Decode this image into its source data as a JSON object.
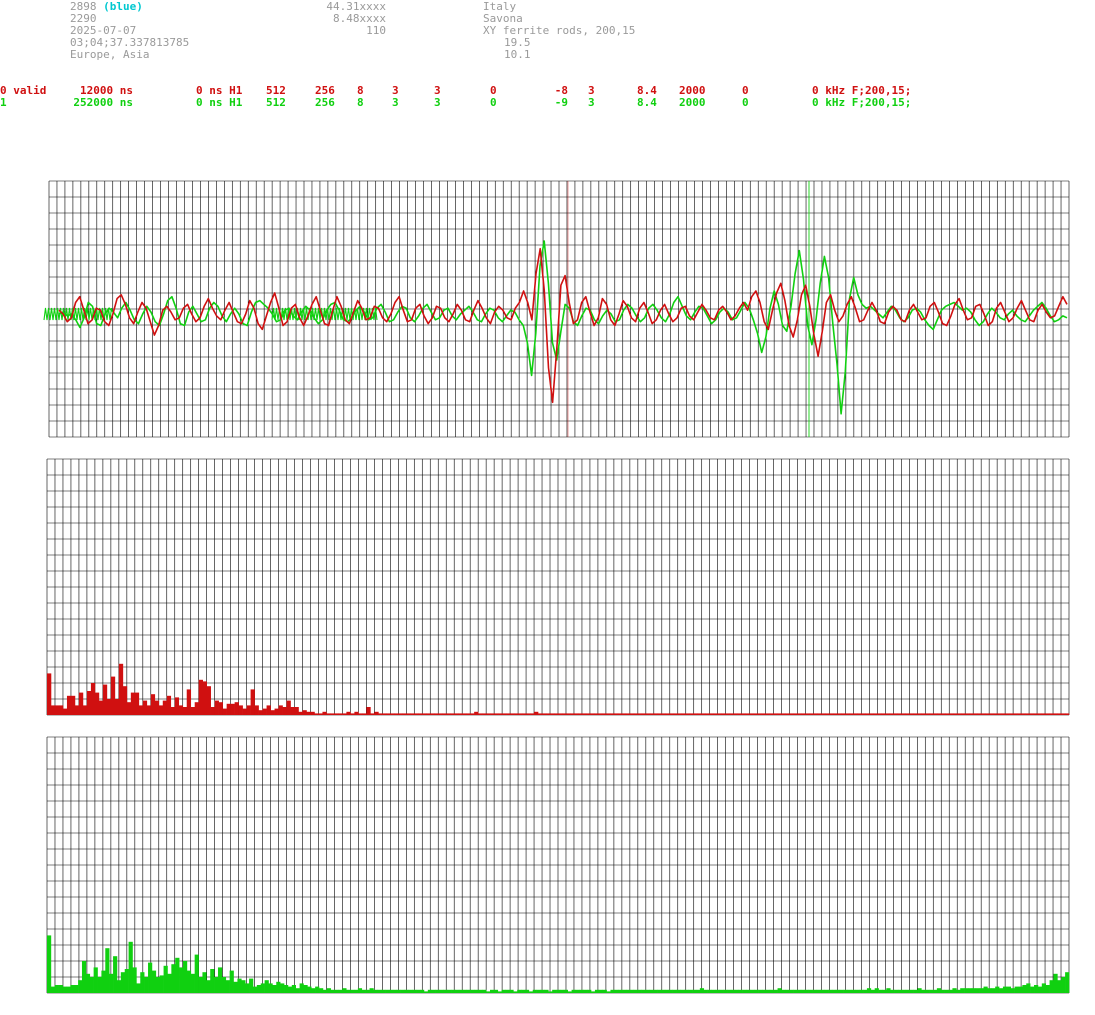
{
  "header": {
    "station_id": "2898",
    "station_tag": "(blue)",
    "station_num2": "2290",
    "date": "2025-07-07",
    "time": "03;04;37.337813785",
    "region": "Europe, Asia",
    "lat": "44.31xxxx",
    "lon": "8.48xxxx",
    "alt": "110",
    "country": "Italy",
    "city": "Savona",
    "antenna": "XY ferrite rods, 200,15",
    "val1": "19.5",
    "val2": "10.1"
  },
  "channels": [
    {
      "c0": "0 valid",
      "c1": "12000 ns",
      "c2": "0 ns H1",
      "c3": "512",
      "c4": "256",
      "c5": "8",
      "c6": "3",
      "c7": "3",
      "c8": "0",
      "c9": "-8",
      "c10": "3",
      "c11": "8.4",
      "c12": "2000",
      "c13": "0",
      "c14": "0 kHz F;200,15;",
      "color": "#d01010"
    },
    {
      "c0": "1",
      "c1": "252000 ns",
      "c2": "0 ns H1",
      "c3": "512",
      "c4": "256",
      "c5": "8",
      "c6": "3",
      "c7": "3",
      "c8": "0",
      "c9": "-9",
      "c10": "3",
      "c11": "8.4",
      "c12": "2000",
      "c13": "0",
      "c14": "0 kHz F;200,15;",
      "color": "#10d010"
    }
  ],
  "chart_data": [
    {
      "type": "line",
      "series": [
        {
          "values": [
            0.2,
            0.0,
            -0.4,
            -0.2,
            0.6,
            0.9,
            0.2,
            -0.5,
            -0.3,
            0.3,
            0.2,
            -0.4,
            -0.6,
            0.0,
            0.8,
            1.0,
            0.5,
            -0.2,
            -0.5,
            0.1,
            0.6,
            0.3,
            -0.4,
            -1.1,
            -0.6,
            0.2,
            0.4,
            0.1,
            -0.3,
            -0.2,
            0.3,
            0.5,
            0.0,
            -0.4,
            -0.2,
            0.4,
            0.8,
            0.3,
            -0.1,
            -0.3,
            0.2,
            0.6,
            0.1,
            -0.4,
            -0.5,
            0.0,
            0.7,
            0.3,
            -0.5,
            -0.8,
            -0.1,
            0.6,
            1.1,
            0.3,
            -0.6,
            -0.4,
            0.3,
            0.5,
            -0.2,
            -0.6,
            -0.1,
            0.5,
            0.9,
            0.2,
            -0.5,
            -0.6,
            0.2,
            0.9,
            0.4,
            -0.3,
            -0.5,
            0.1,
            0.7,
            0.3,
            -0.3,
            -0.2,
            0.4,
            0.3,
            -0.2,
            -0.4,
            0.0,
            0.6,
            0.9,
            0.2,
            -0.4,
            -0.3,
            0.3,
            0.5,
            -0.1,
            -0.5,
            -0.2,
            0.4,
            0.3,
            -0.2,
            -0.4,
            0.0,
            0.5,
            0.2,
            -0.3,
            -0.4,
            0.2,
            0.7,
            0.3,
            -0.2,
            -0.5,
            0.1,
            0.4,
            0.2,
            -0.2,
            -0.3,
            0.3,
            0.6,
            1.2,
            0.6,
            -0.3,
            2.1,
            3.4,
            1.2,
            -2.8,
            -4.6,
            -1.8,
            1.5,
            2.0,
            0.6,
            -0.5,
            -0.3,
            0.6,
            0.9,
            0.1,
            -0.6,
            -0.2,
            0.8,
            0.5,
            -0.3,
            -0.6,
            0.0,
            0.7,
            0.4,
            -0.2,
            -0.4,
            0.3,
            0.6,
            0.1,
            -0.5,
            -0.3,
            0.2,
            0.5,
            0.0,
            -0.4,
            -0.2,
            0.3,
            0.4,
            -0.1,
            -0.3,
            0.1,
            0.5,
            0.2,
            -0.2,
            -0.3,
            0.2,
            0.4,
            0.1,
            -0.3,
            -0.1,
            0.3,
            0.6,
            0.2,
            0.9,
            1.2,
            0.6,
            -0.4,
            -0.8,
            0.2,
            1.1,
            1.6,
            0.7,
            -0.6,
            -1.2,
            -0.3,
            1.0,
            1.5,
            0.4,
            -1.1,
            -2.2,
            -0.9,
            0.6,
            1.0,
            0.2,
            -0.4,
            -0.1,
            0.5,
            0.9,
            0.3,
            -0.4,
            -0.3,
            0.2,
            0.6,
            0.2,
            -0.4,
            -0.5,
            0.1,
            0.4,
            0.2,
            -0.3,
            -0.4,
            0.2,
            0.5,
            0.1,
            -0.3,
            -0.2,
            0.4,
            0.6,
            0.1,
            -0.5,
            -0.6,
            -0.1,
            0.5,
            0.8,
            0.2,
            -0.3,
            -0.2,
            0.4,
            0.5,
            0.0,
            -0.6,
            -0.4,
            0.3,
            0.6,
            0.1,
            -0.4,
            -0.2,
            0.3,
            0.7,
            0.2,
            -0.3,
            -0.4,
            0.2,
            0.5,
            0.1,
            -0.2,
            -0.1,
            0.4,
            0.9,
            0.5
          ]
        },
        {
          "values": [
            0.0,
            0.1,
            -0.1,
            0.0,
            -0.3,
            -0.7,
            -0.2,
            0.6,
            0.4,
            -0.5,
            -0.6,
            0.0,
            0.3,
            0.1,
            -0.2,
            0.3,
            0.6,
            0.2,
            -0.3,
            -0.5,
            0.0,
            0.4,
            0.1,
            -0.4,
            -0.6,
            0.0,
            0.7,
            0.9,
            0.3,
            -0.5,
            -0.6,
            0.1,
            0.4,
            0.0,
            -0.4,
            -0.3,
            0.3,
            0.6,
            0.4,
            -0.1,
            -0.4,
            0.0,
            0.3,
            0.0,
            -0.5,
            -0.6,
            0.1,
            0.6,
            0.7,
            0.5,
            0.3,
            0.0,
            -0.4,
            -0.3,
            0.2,
            0.3,
            -0.1,
            -0.3,
            0.1,
            0.4,
            0.2,
            -0.2,
            -0.5,
            -0.3,
            0.2,
            0.5,
            0.6,
            0.2,
            -0.3,
            -0.4,
            -0.2,
            0.2,
            0.4,
            0.1,
            -0.3,
            -0.2,
            0.3,
            0.5,
            0.1,
            -0.4,
            -0.3,
            0.1,
            0.4,
            0.3,
            -0.2,
            -0.4,
            -0.1,
            0.3,
            0.5,
            0.1,
            -0.3,
            -0.2,
            0.2,
            0.3,
            -0.1,
            -0.3,
            0.0,
            0.2,
            0.4,
            0.1,
            -0.3,
            -0.4,
            0.0,
            0.3,
            0.2,
            -0.2,
            -0.4,
            -0.1,
            0.2,
            0.1,
            -0.3,
            -0.6,
            -1.5,
            -3.2,
            -1.0,
            2.5,
            3.8,
            1.6,
            -1.5,
            -2.4,
            -0.9,
            0.5,
            0.3,
            -0.4,
            -0.6,
            -0.1,
            0.3,
            0.2,
            -0.3,
            -0.5,
            -0.1,
            0.2,
            0.0,
            -0.4,
            -0.3,
            0.2,
            0.5,
            0.3,
            -0.1,
            -0.4,
            -0.2,
            0.3,
            0.5,
            0.2,
            -0.2,
            -0.4,
            0.0,
            0.6,
            0.9,
            0.4,
            -0.1,
            -0.3,
            0.1,
            0.4,
            0.3,
            -0.1,
            -0.5,
            -0.3,
            0.1,
            0.3,
            0.1,
            -0.3,
            -0.2,
            0.2,
            0.6,
            0.3,
            -0.3,
            -1.0,
            -2.0,
            -1.2,
            0.3,
            1.2,
            0.5,
            -0.6,
            -0.9,
            0.4,
            2.1,
            3.3,
            1.8,
            -0.6,
            -1.6,
            -0.3,
            1.6,
            3.0,
            1.9,
            -0.5,
            -2.6,
            -5.2,
            -3.0,
            0.8,
            1.9,
            1.0,
            0.5,
            0.3,
            0.4,
            0.2,
            0.0,
            -0.2,
            0.1,
            0.4,
            0.2,
            -0.2,
            -0.4,
            -0.2,
            0.2,
            0.3,
            0.1,
            -0.3,
            -0.6,
            -0.8,
            -0.3,
            0.2,
            0.4,
            0.5,
            0.6,
            0.4,
            0.2,
            0.3,
            0.1,
            -0.3,
            -0.6,
            -0.4,
            0.0,
            0.3,
            0.1,
            -0.2,
            -0.3,
            0.0,
            0.2,
            -0.1,
            -0.3,
            -0.4,
            -0.1,
            0.2,
            0.4,
            0.6,
            0.3,
            -0.1,
            -0.4,
            -0.3,
            -0.1,
            -0.2
          ]
        }
      ],
      "ylim": [
        -6,
        6
      ],
      "grid": true
    },
    {
      "type": "bar",
      "values": [
        2.6,
        0.6,
        0.6,
        0.6,
        0.4,
        1.2,
        1.2,
        0.6,
        1.4,
        0.6,
        1.5,
        2.0,
        1.4,
        0.9,
        1.9,
        1.0,
        2.4,
        1.0,
        3.2,
        1.8,
        0.8,
        1.4,
        1.4,
        0.6,
        0.9,
        0.6,
        1.3,
        0.9,
        0.6,
        0.9,
        1.2,
        0.5,
        1.1,
        0.6,
        0.5,
        1.6,
        0.5,
        0.8,
        2.2,
        2.1,
        1.8,
        0.5,
        0.9,
        0.8,
        0.4,
        0.7,
        0.7,
        0.8,
        0.6,
        0.4,
        0.6,
        1.6,
        0.6,
        0.3,
        0.4,
        0.6,
        0.3,
        0.4,
        0.6,
        0.5,
        0.9,
        0.5,
        0.5,
        0.2,
        0.3,
        0.2,
        0.2,
        0.1,
        0.1,
        0.2,
        0.1,
        0.1,
        0.1,
        0.1,
        0.1,
        0.2,
        0.1,
        0.2,
        0.1,
        0.1,
        0.5,
        0.1,
        0.2,
        0.1,
        0.1,
        0.1,
        0.1,
        0.1,
        0.1,
        0.1,
        0.1,
        0.1,
        0.1,
        0.1,
        0.1,
        0.1,
        0.1,
        0.1,
        0.1,
        0.1,
        0.1,
        0.1,
        0.1,
        0.1,
        0.1,
        0.1,
        0.1,
        0.2,
        0.1,
        0.1,
        0.1,
        0.1,
        0.1,
        0.1,
        0.1,
        0.1,
        0.1,
        0.1,
        0.1,
        0.1,
        0.1,
        0.1,
        0.2,
        0.1,
        0.1,
        0.1,
        0.1,
        0.1,
        0.1,
        0.1,
        0.1,
        0.1,
        0.1,
        0.1,
        0.1,
        0.1,
        0.1,
        0.1,
        0.1,
        0.1,
        0.1,
        0.1,
        0.1,
        0.1,
        0.1,
        0.1,
        0.1,
        0.1,
        0.1,
        0.1,
        0.1,
        0.1,
        0.1,
        0.1,
        0.1,
        0.1,
        0.1,
        0.1,
        0.1,
        0.1,
        0.1,
        0.1,
        0.1,
        0.1,
        0.1,
        0.1,
        0.1,
        0.1,
        0.1,
        0.1,
        0.1,
        0.1,
        0.1,
        0.1,
        0.1,
        0.1,
        0.1,
        0.1,
        0.1,
        0.1,
        0.1,
        0.1,
        0.1,
        0.1,
        0.1,
        0.1,
        0.1,
        0.1,
        0.1,
        0.1,
        0.1,
        0.1,
        0.1,
        0.1,
        0.1,
        0.1,
        0.1,
        0.1,
        0.1,
        0.1,
        0.1,
        0.1,
        0.1,
        0.1,
        0.1,
        0.1,
        0.1,
        0.1,
        0.1,
        0.1,
        0.1,
        0.1,
        0.1,
        0.1,
        0.1,
        0.1,
        0.1,
        0.1,
        0.1,
        0.1,
        0.1,
        0.1,
        0.1,
        0.1,
        0.1,
        0.1,
        0.1,
        0.1,
        0.1,
        0.1,
        0.1,
        0.1,
        0.1,
        0.1,
        0.1,
        0.1,
        0.1,
        0.1,
        0.1,
        0.1,
        0.1,
        0.1,
        0.1,
        0.1,
        0.1,
        0.1,
        0.1,
        0.1,
        0.1,
        0.1,
        0.1,
        0.1,
        0.1,
        0.1,
        0.1,
        0.1
      ],
      "ylim": [
        0,
        16
      ],
      "grid": true
    },
    {
      "type": "bar",
      "values": [
        3.6,
        0.4,
        0.5,
        0.5,
        0.4,
        0.4,
        0.5,
        0.5,
        0.8,
        2.0,
        1.2,
        1.0,
        1.6,
        1.0,
        1.4,
        2.8,
        1.2,
        2.3,
        0.8,
        1.3,
        1.5,
        3.2,
        1.6,
        0.6,
        1.3,
        1.0,
        1.9,
        1.4,
        1.0,
        1.1,
        1.7,
        1.2,
        1.8,
        2.2,
        1.6,
        2.0,
        1.4,
        1.2,
        2.4,
        1.0,
        1.3,
        0.8,
        1.5,
        1.0,
        1.6,
        1.0,
        0.8,
        1.4,
        0.7,
        0.9,
        0.8,
        0.6,
        0.9,
        0.4,
        0.5,
        0.6,
        0.8,
        0.6,
        0.5,
        0.7,
        0.6,
        0.5,
        0.4,
        0.5,
        0.3,
        0.6,
        0.5,
        0.4,
        0.3,
        0.4,
        0.3,
        0.2,
        0.3,
        0.2,
        0.2,
        0.2,
        0.3,
        0.2,
        0.2,
        0.2,
        0.3,
        0.2,
        0.2,
        0.3,
        0.2,
        0.2,
        0.2,
        0.2,
        0.2,
        0.2,
        0.2,
        0.2,
        0.2,
        0.2,
        0.2,
        0.2,
        0.2,
        0.1,
        0.2,
        0.2,
        0.2,
        0.2,
        0.2,
        0.2,
        0.2,
        0.2,
        0.2,
        0.2,
        0.2,
        0.2,
        0.2,
        0.2,
        0.2,
        0.1,
        0.2,
        0.2,
        0.1,
        0.2,
        0.2,
        0.2,
        0.1,
        0.2,
        0.2,
        0.2,
        0.1,
        0.2,
        0.2,
        0.2,
        0.2,
        0.1,
        0.2,
        0.2,
        0.2,
        0.2,
        0.1,
        0.2,
        0.2,
        0.2,
        0.2,
        0.2,
        0.1,
        0.2,
        0.2,
        0.2,
        0.1,
        0.2,
        0.2,
        0.2,
        0.2,
        0.2,
        0.2,
        0.2,
        0.2,
        0.2,
        0.2,
        0.2,
        0.2,
        0.2,
        0.2,
        0.2,
        0.2,
        0.2,
        0.2,
        0.2,
        0.2,
        0.2,
        0.2,
        0.2,
        0.3,
        0.2,
        0.2,
        0.2,
        0.2,
        0.2,
        0.2,
        0.2,
        0.2,
        0.2,
        0.2,
        0.2,
        0.2,
        0.2,
        0.2,
        0.2,
        0.2,
        0.2,
        0.2,
        0.2,
        0.3,
        0.2,
        0.2,
        0.2,
        0.2,
        0.2,
        0.2,
        0.2,
        0.2,
        0.2,
        0.2,
        0.2,
        0.2,
        0.2,
        0.2,
        0.2,
        0.2,
        0.2,
        0.2,
        0.2,
        0.2,
        0.2,
        0.2,
        0.3,
        0.2,
        0.3,
        0.2,
        0.2,
        0.3,
        0.2,
        0.2,
        0.2,
        0.2,
        0.2,
        0.2,
        0.2,
        0.3,
        0.2,
        0.2,
        0.2,
        0.2,
        0.3,
        0.2,
        0.2,
        0.2,
        0.3,
        0.2,
        0.3,
        0.3,
        0.3,
        0.3,
        0.3,
        0.3,
        0.4,
        0.3,
        0.3,
        0.4,
        0.3,
        0.4,
        0.4,
        0.3,
        0.4,
        0.4,
        0.5,
        0.6,
        0.4,
        0.5,
        0.4,
        0.6,
        0.5,
        0.8,
        1.2,
        0.8,
        1.0,
        1.3
      ],
      "ylim": [
        0,
        16
      ],
      "grid": true
    }
  ]
}
